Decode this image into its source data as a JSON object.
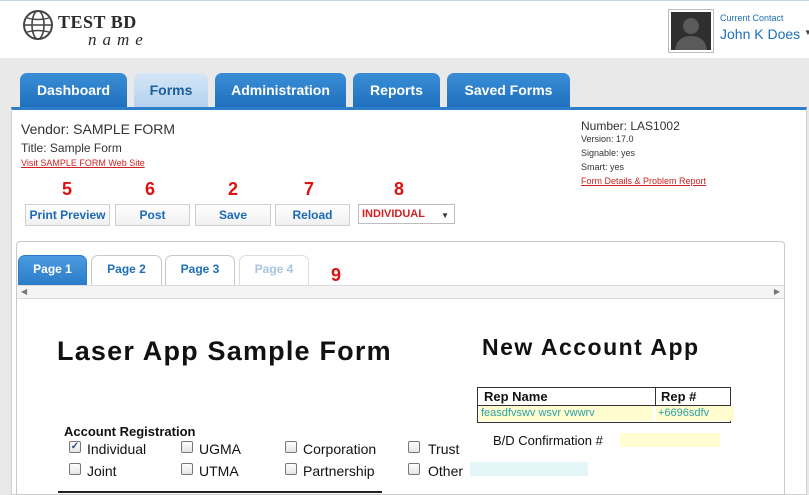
{
  "header": {
    "logo_line1": "TEST BD",
    "logo_line2": "name",
    "contact_label": "Current Contact",
    "contact_name": "John K Does"
  },
  "nav": {
    "tabs": [
      {
        "label": "Dashboard",
        "active": false
      },
      {
        "label": "Forms",
        "active": true
      },
      {
        "label": "Administration",
        "active": false
      },
      {
        "label": "Reports",
        "active": false
      },
      {
        "label": "Saved Forms",
        "active": false
      }
    ]
  },
  "form_info": {
    "vendor_label": "Vendor:",
    "vendor": "SAMPLE FORM",
    "title_label": "Title:",
    "title": "Sample Form",
    "visit_link": "Visit SAMPLE FORM Web Site",
    "number_label": "Number:",
    "number": "LAS1002",
    "version_label": "Version:",
    "version": "17.0",
    "signable_label": "Signable:",
    "signable": "yes",
    "smart_label": "Smart:",
    "smart": "yes",
    "details_link": "Form Details & Problem Report"
  },
  "toolbar": {
    "step_labels": [
      "5",
      "6",
      "2",
      "7",
      "8"
    ],
    "print_preview": "Print Preview",
    "post": "Post",
    "save": "Save",
    "reload": "Reload",
    "mode_selected": "INDIVIDUAL"
  },
  "pages": {
    "tabs": [
      {
        "label": "Page 1",
        "state": "active"
      },
      {
        "label": "Page 2",
        "state": "normal"
      },
      {
        "label": "Page 3",
        "state": "normal"
      },
      {
        "label": "Page 4",
        "state": "disabled"
      }
    ],
    "step_label": "9"
  },
  "form": {
    "title": "Laser App Sample Form",
    "subtitle": "New Account App",
    "rep_name_header": "Rep Name",
    "rep_num_header": "Rep #",
    "rep_name_value": "feasdfvswv wsvr vwwrv",
    "rep_num_value": "+6696sdfv",
    "bd_confirmation_label": "B/D Confirmation #",
    "bd_confirmation_value": "",
    "account_registration_label": "Account Registration",
    "options": [
      {
        "label": "Individual",
        "checked": true
      },
      {
        "label": "Joint",
        "checked": false
      },
      {
        "label": "UGMA",
        "checked": false
      },
      {
        "label": "UTMA",
        "checked": false
      },
      {
        "label": "Corporation",
        "checked": false
      },
      {
        "label": "Partnership",
        "checked": false
      },
      {
        "label": "Trust",
        "checked": false
      },
      {
        "label": "Other",
        "checked": false
      }
    ],
    "other_value": ""
  },
  "icons": {
    "logo": "globe-icon",
    "avatar": "user-silhouette-icon",
    "contact_menu": "caret-down-icon",
    "mode_select": "caret-down-icon",
    "scroll_left": "arrow-left-icon",
    "scroll_right": "arrow-right-icon",
    "checkmark": "check-icon"
  },
  "colors": {
    "nav_blue": "#1f6fbd",
    "nav_active": "#b4d1ee",
    "link_red": "#cc2222",
    "step_red": "#dd1111",
    "field_yellow": "#fffdd0",
    "field_text": "#2aa0a8"
  }
}
